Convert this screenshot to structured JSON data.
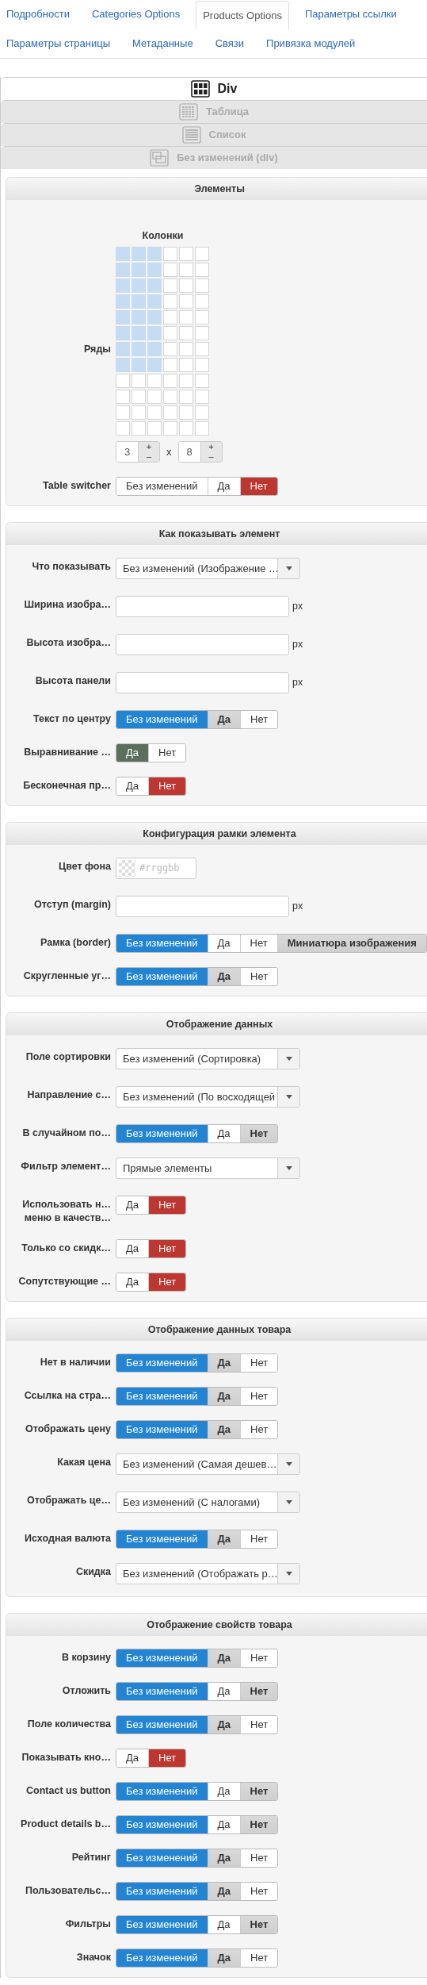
{
  "tabs": [
    {
      "label": "Подробности",
      "selected": false
    },
    {
      "label": "Categories Options",
      "selected": false
    },
    {
      "label": "Products Options",
      "selected": true
    },
    {
      "label": "Параметры ссылки",
      "selected": false
    },
    {
      "label": "Параметры страницы",
      "selected": false
    },
    {
      "label": "Метаданные",
      "selected": false
    },
    {
      "label": "Связи",
      "selected": false
    },
    {
      "label": "Привязка модулей",
      "selected": false
    }
  ],
  "layouts": [
    {
      "label": "Div",
      "kind": "grid",
      "selected": true
    },
    {
      "label": "Таблица",
      "kind": "table",
      "selected": false
    },
    {
      "label": "Список",
      "kind": "list",
      "selected": false
    },
    {
      "label": "Без изменений (div)",
      "kind": "div",
      "selected": false
    }
  ],
  "sections": [
    {
      "title": "Элементы",
      "rows": [
        {
          "kind": "grid",
          "columns_label": "Колонки",
          "rows_label": "Ряды",
          "columns": "3",
          "separator": "x",
          "rows": "8",
          "plus": "+",
          "minus": "–"
        },
        {
          "kind": "toggle",
          "label": "Table switcher",
          "options": [
            {
              "label": "Без изменений",
              "selected": false,
              "default": false
            },
            {
              "label": "Да",
              "selected": false,
              "default": false
            },
            {
              "label": "Нет",
              "kind": "no",
              "selected": true,
              "default": false
            }
          ]
        }
      ]
    },
    {
      "title": "Как показывать элемент",
      "rows": [
        {
          "kind": "select",
          "label": "Что показывать",
          "value": "Без изменений (Изображение …"
        },
        {
          "kind": "text",
          "label": "Ширина изобра…",
          "unit": "px"
        },
        {
          "kind": "text",
          "label": "Высота изобра…",
          "unit": "px"
        },
        {
          "kind": "text",
          "label": "Высота панели",
          "unit": "px"
        },
        {
          "kind": "toggle",
          "label": "Текст по центру",
          "options": [
            {
              "label": "Без изменений",
              "kind": "inherit",
              "selected": true,
              "default": false
            },
            {
              "label": "Да",
              "kind": "yes",
              "selected": false,
              "default": true
            },
            {
              "label": "Нет",
              "kind": "no",
              "selected": false,
              "default": false
            }
          ]
        },
        {
          "kind": "toggle",
          "label": "Выравнивание …",
          "options": [
            {
              "label": "Да",
              "kind": "yes",
              "selected": true,
              "default": false
            },
            {
              "label": "Нет",
              "selected": false,
              "default": false
            }
          ]
        },
        {
          "kind": "toggle",
          "label": "Бесконечная пр…",
          "options": [
            {
              "label": "Да",
              "selected": false,
              "default": false
            },
            {
              "label": "Нет",
              "kind": "no",
              "selected": true,
              "default": false
            }
          ]
        }
      ]
    },
    {
      "title": "Конфигурация рамки элемента",
      "rows": [
        {
          "kind": "color",
          "label": "Цвет фона",
          "placeholder": "#rrggbb"
        },
        {
          "kind": "text",
          "label": "Отступ (margin)",
          "unit": "px"
        },
        {
          "kind": "toggle",
          "label": "Рамка (border)",
          "options": [
            {
              "label": "Без изменений",
              "kind": "inherit",
              "selected": true,
              "default": false
            },
            {
              "label": "Да",
              "selected": false,
              "default": false
            },
            {
              "label": "Нет",
              "selected": false,
              "default": false
            },
            {
              "label": "Миниатюра изображения",
              "selected": false,
              "default": true
            }
          ]
        },
        {
          "kind": "toggle",
          "label": "Скругленные уг…",
          "options": [
            {
              "label": "Без изменений",
              "kind": "inherit",
              "selected": true,
              "default": false
            },
            {
              "label": "Да",
              "kind": "yes",
              "selected": false,
              "default": true
            },
            {
              "label": "Нет",
              "kind": "no",
              "selected": false,
              "default": false
            }
          ]
        }
      ]
    },
    {
      "title": "Отображение данных",
      "rows": [
        {
          "kind": "select",
          "label": "Поле сортировки",
          "value": "Без изменений (Сортировка)"
        },
        {
          "kind": "select",
          "label": "Направление с…",
          "value": "Без изменений (По восходящей"
        },
        {
          "kind": "toggle",
          "label": "В случайном по…",
          "options": [
            {
              "label": "Без изменений",
              "kind": "inherit",
              "selected": true,
              "default": false
            },
            {
              "label": "Да",
              "kind": "yes",
              "selected": false,
              "default": false
            },
            {
              "label": "Нет",
              "kind": "no",
              "selected": false,
              "default": true
            }
          ]
        },
        {
          "kind": "select",
          "label": "Фильтр элемент…",
          "value": "Прямые элементы"
        },
        {
          "kind": "toggle",
          "label": "Использовать н…\nменю в качеств…",
          "options": [
            {
              "label": "Да",
              "selected": false,
              "default": false
            },
            {
              "label": "Нет",
              "kind": "no",
              "selected": true,
              "default": false
            }
          ]
        },
        {
          "kind": "toggle",
          "label": "Только со скидк…",
          "options": [
            {
              "label": "Да",
              "selected": false,
              "default": false
            },
            {
              "label": "Нет",
              "kind": "no",
              "selected": true,
              "default": false
            }
          ]
        },
        {
          "kind": "toggle",
          "label": "Сопутствующие …",
          "options": [
            {
              "label": "Да",
              "selected": false,
              "default": false
            },
            {
              "label": "Нет",
              "kind": "no",
              "selected": true,
              "default": false
            }
          ]
        }
      ]
    },
    {
      "title": "Отображение данных товара",
      "rows": [
        {
          "kind": "toggle",
          "label": "Нет в наличии",
          "options": [
            {
              "label": "Без изменений",
              "kind": "inherit",
              "selected": true,
              "default": false
            },
            {
              "label": "Да",
              "kind": "yes",
              "selected": false,
              "default": true
            },
            {
              "label": "Нет",
              "kind": "no",
              "selected": false,
              "default": false
            }
          ]
        },
        {
          "kind": "toggle",
          "label": "Ссылка на стра…",
          "options": [
            {
              "label": "Без изменений",
              "kind": "inherit",
              "selected": true,
              "default": false
            },
            {
              "label": "Да",
              "kind": "yes",
              "selected": false,
              "default": true
            },
            {
              "label": "Нет",
              "kind": "no",
              "selected": false,
              "default": false
            }
          ]
        },
        {
          "kind": "toggle",
          "label": "Отображать цену",
          "options": [
            {
              "label": "Без изменений",
              "kind": "inherit",
              "selected": true,
              "default": false
            },
            {
              "label": "Да",
              "kind": "yes",
              "selected": false,
              "default": true
            },
            {
              "label": "Нет",
              "kind": "no",
              "selected": false,
              "default": false
            }
          ]
        },
        {
          "kind": "select",
          "label": "Какая цена",
          "value": "Без изменений (Самая дешев…"
        },
        {
          "kind": "select",
          "label": "Отображать це…",
          "value": "Без изменений (С налогами)"
        },
        {
          "kind": "toggle",
          "label": "Исходная валюта",
          "options": [
            {
              "label": "Без изменений",
              "kind": "inherit",
              "selected": true,
              "default": false
            },
            {
              "label": "Да",
              "kind": "yes",
              "selected": false,
              "default": true
            },
            {
              "label": "Нет",
              "kind": "no",
              "selected": false,
              "default": false
            }
          ]
        },
        {
          "kind": "select",
          "label": "Скидка",
          "value": "Без изменений (Отображать р…"
        }
      ]
    },
    {
      "title": "Отображение свойств товара",
      "rows": [
        {
          "kind": "toggle",
          "label": "В корзину",
          "options": [
            {
              "label": "Без изменений",
              "kind": "inherit",
              "selected": true,
              "default": false
            },
            {
              "label": "Да",
              "kind": "yes",
              "selected": false,
              "default": true
            },
            {
              "label": "Нет",
              "kind": "no",
              "selected": false,
              "default": false
            }
          ]
        },
        {
          "kind": "toggle",
          "label": "Отложить",
          "options": [
            {
              "label": "Без изменений",
              "kind": "inherit",
              "selected": true,
              "default": false
            },
            {
              "label": "Да",
              "kind": "yes",
              "selected": false,
              "default": false
            },
            {
              "label": "Нет",
              "kind": "no",
              "selected": false,
              "default": true
            }
          ]
        },
        {
          "kind": "toggle",
          "label": "Поле количества",
          "options": [
            {
              "label": "Без изменений",
              "kind": "inherit",
              "selected": true,
              "default": false
            },
            {
              "label": "Да",
              "kind": "yes",
              "selected": false,
              "default": true
            },
            {
              "label": "Нет",
              "kind": "no",
              "selected": false,
              "default": false
            }
          ]
        },
        {
          "kind": "toggle",
          "label": "Показывать кно…",
          "options": [
            {
              "label": "Да",
              "selected": false,
              "default": false
            },
            {
              "label": "Нет",
              "kind": "no",
              "selected": true,
              "default": false
            }
          ]
        },
        {
          "kind": "toggle",
          "label": "Contact us button",
          "options": [
            {
              "label": "Без изменений",
              "kind": "inherit",
              "selected": true,
              "default": false
            },
            {
              "label": "Да",
              "kind": "yes",
              "selected": false,
              "default": false
            },
            {
              "label": "Нет",
              "kind": "no",
              "selected": false,
              "default": true
            }
          ]
        },
        {
          "kind": "toggle",
          "label": "Product details b…",
          "options": [
            {
              "label": "Без изменений",
              "kind": "inherit",
              "selected": true,
              "default": false
            },
            {
              "label": "Да",
              "kind": "yes",
              "selected": false,
              "default": false
            },
            {
              "label": "Нет",
              "kind": "no",
              "selected": false,
              "default": true
            }
          ]
        },
        {
          "kind": "toggle",
          "label": "Рейтинг",
          "options": [
            {
              "label": "Без изменений",
              "kind": "inherit",
              "selected": true,
              "default": false
            },
            {
              "label": "Да",
              "kind": "yes",
              "selected": false,
              "default": true
            },
            {
              "label": "Нет",
              "kind": "no",
              "selected": false,
              "default": false
            }
          ]
        },
        {
          "kind": "toggle",
          "label": "Пользовательс…",
          "options": [
            {
              "label": "Без изменений",
              "kind": "inherit",
              "selected": true,
              "default": false
            },
            {
              "label": "Да",
              "kind": "yes",
              "selected": false,
              "default": true
            },
            {
              "label": "Нет",
              "kind": "no",
              "selected": false,
              "default": false
            }
          ]
        },
        {
          "kind": "toggle",
          "label": "Фильтры",
          "options": [
            {
              "label": "Без изменений",
              "kind": "inherit",
              "selected": true,
              "default": false
            },
            {
              "label": "Да",
              "kind": "yes",
              "selected": false,
              "default": false
            },
            {
              "label": "Нет",
              "kind": "no",
              "selected": false,
              "default": true
            }
          ]
        },
        {
          "kind": "toggle",
          "label": "Значок",
          "options": [
            {
              "label": "Без изменений",
              "kind": "inherit",
              "selected": true,
              "default": false
            },
            {
              "label": "Да",
              "kind": "yes",
              "selected": false,
              "default": true
            },
            {
              "label": "Нет",
              "kind": "no",
              "selected": false,
              "default": false
            }
          ]
        }
      ]
    }
  ]
}
